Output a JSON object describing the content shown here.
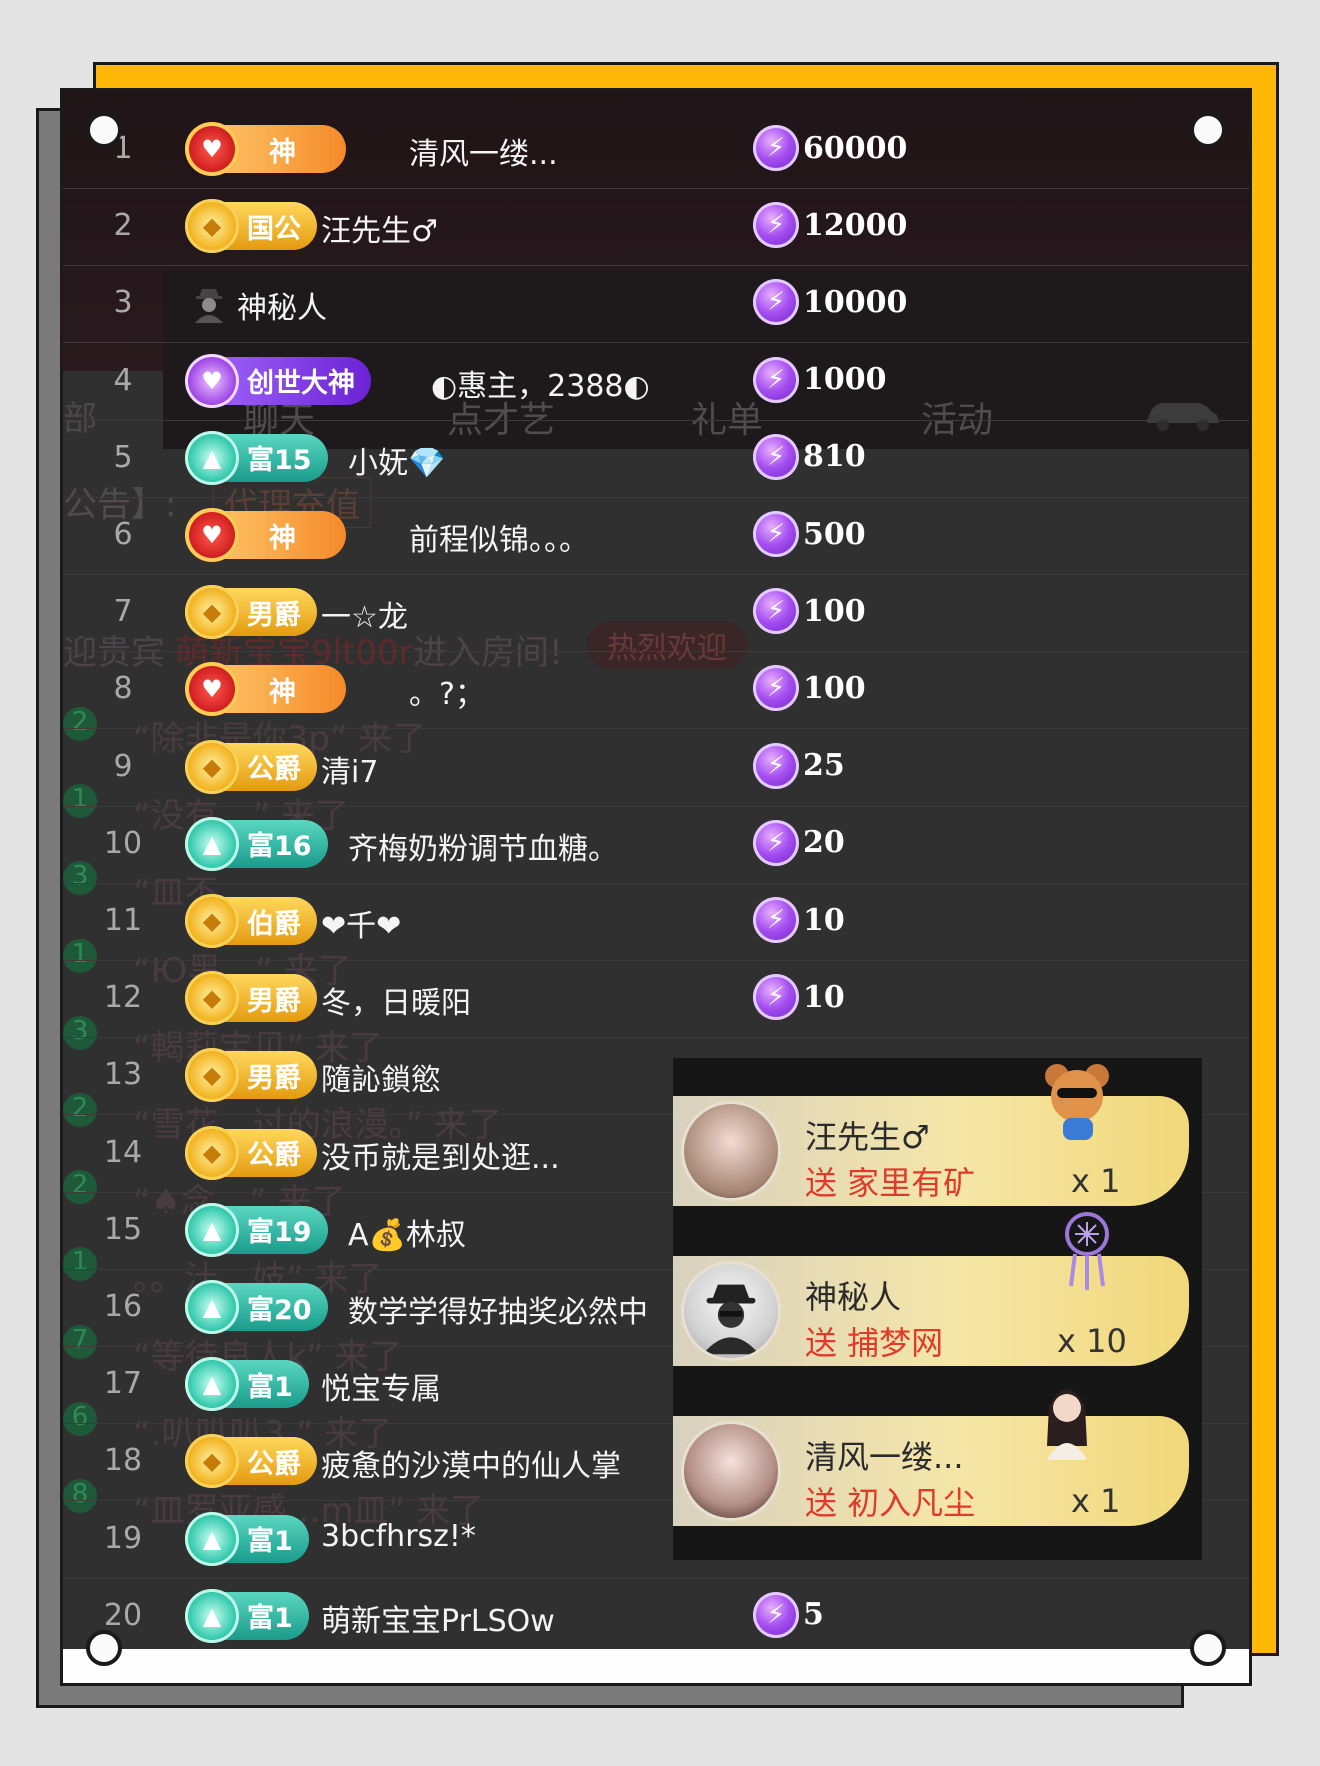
{
  "background_layer": {
    "tabs": [
      "聊天",
      "点才艺",
      "礼单",
      "活动"
    ],
    "left_fragments": [
      "部",
      "公告】:"
    ],
    "recharge_label": "代理充值",
    "welcome": {
      "prefix": "迎贵宾",
      "name": "萌新宝宝9lt00r",
      "suffix": "进入房间!",
      "button": "热烈欢迎"
    },
    "chat": [
      "“除非是你3p” 来了",
      "“没有…” 来了",
      "“皿不…",
      "“Ю黑…” 来了",
      "“輵莉宝贝” 来了",
      "“雪花…过的浪漫。” 来了",
      "“♠念…” 来了",
      "。。汁…妓” 来了",
      "“等待良人k” 来了",
      "“.叭叭叭3.” 来了",
      "“皿罗亚感…m皿” 来了"
    ],
    "chat_levels": [
      "2",
      "1",
      "3",
      "1",
      "3",
      "2",
      "2",
      "1",
      "7",
      "6",
      "8"
    ]
  },
  "ranking": [
    {
      "rank": "1",
      "badge": "神",
      "badge_style": "red",
      "name": "清风一缕...",
      "amount": "60000"
    },
    {
      "rank": "2",
      "badge": "国公",
      "badge_style": "gold",
      "name": "汪先生♂",
      "amount": "12000"
    },
    {
      "rank": "3",
      "badge": "",
      "badge_style": "none",
      "name": "神秘人",
      "amount": "10000"
    },
    {
      "rank": "4",
      "badge": "创世大神",
      "badge_style": "purple",
      "name": "◐惠主，2388◐",
      "amount": "1000"
    },
    {
      "rank": "5",
      "badge": "富15",
      "badge_style": "teal",
      "name": "小妩💎",
      "amount": "810"
    },
    {
      "rank": "6",
      "badge": "神",
      "badge_style": "red",
      "name": "前程似锦。。。",
      "amount": "500"
    },
    {
      "rank": "7",
      "badge": "男爵",
      "badge_style": "gold",
      "name": "一☆龙",
      "amount": "100"
    },
    {
      "rank": "8",
      "badge": "神",
      "badge_style": "red",
      "name": "。?；",
      "amount": "100"
    },
    {
      "rank": "9",
      "badge": "公爵",
      "badge_style": "gold",
      "name": "清i7",
      "amount": "25"
    },
    {
      "rank": "10",
      "badge": "富16",
      "badge_style": "teal",
      "name": "齐梅奶粉调节血糖。",
      "amount": "20"
    },
    {
      "rank": "11",
      "badge": "伯爵",
      "badge_style": "gold",
      "name": "❤千❤",
      "amount": "10"
    },
    {
      "rank": "12",
      "badge": "男爵",
      "badge_style": "gold",
      "name": "冬，日暖阳",
      "amount": "10"
    },
    {
      "rank": "13",
      "badge": "男爵",
      "badge_style": "gold",
      "name": "隨訫鎖慾",
      "amount": ""
    },
    {
      "rank": "14",
      "badge": "公爵",
      "badge_style": "gold",
      "name": "没币就是到处逛...",
      "amount": ""
    },
    {
      "rank": "15",
      "badge": "富19",
      "badge_style": "teal",
      "name": "A💰林叔",
      "amount": ""
    },
    {
      "rank": "16",
      "badge": "富20",
      "badge_style": "teal",
      "name": "数学学得好抽奖必然中",
      "amount": ""
    },
    {
      "rank": "17",
      "badge": "富1",
      "badge_style": "teal",
      "name": "悦宝专属",
      "amount": ""
    },
    {
      "rank": "18",
      "badge": "公爵",
      "badge_style": "gold",
      "name": "疲惫的沙漠中的仙人掌",
      "amount": ""
    },
    {
      "rank": "19",
      "badge": "富1",
      "badge_style": "teal",
      "name": "3bcfhrsz!*",
      "amount": ""
    },
    {
      "rank": "20",
      "badge": "富1",
      "badge_style": "teal",
      "name": "萌新宝宝PrLSOw",
      "amount": "5"
    }
  ],
  "gifts": [
    {
      "user": "汪先生♂",
      "action": "送 家里有矿",
      "count": "x 1",
      "gift_icon": "bear-sunglasses-icon"
    },
    {
      "user": "神秘人",
      "action": "送 捕梦网",
      "count": "x 10",
      "gift_icon": "dreamcatcher-icon"
    },
    {
      "user": "清风一缕...",
      "action": "送 初入凡尘",
      "count": "x 1",
      "gift_icon": "fairy-girl-icon"
    }
  ],
  "colors": {
    "frame_yellow": "#ffb808",
    "panel": "#303030",
    "gift_red": "#e03a2a",
    "bolt_purple": "#a54ef0"
  }
}
